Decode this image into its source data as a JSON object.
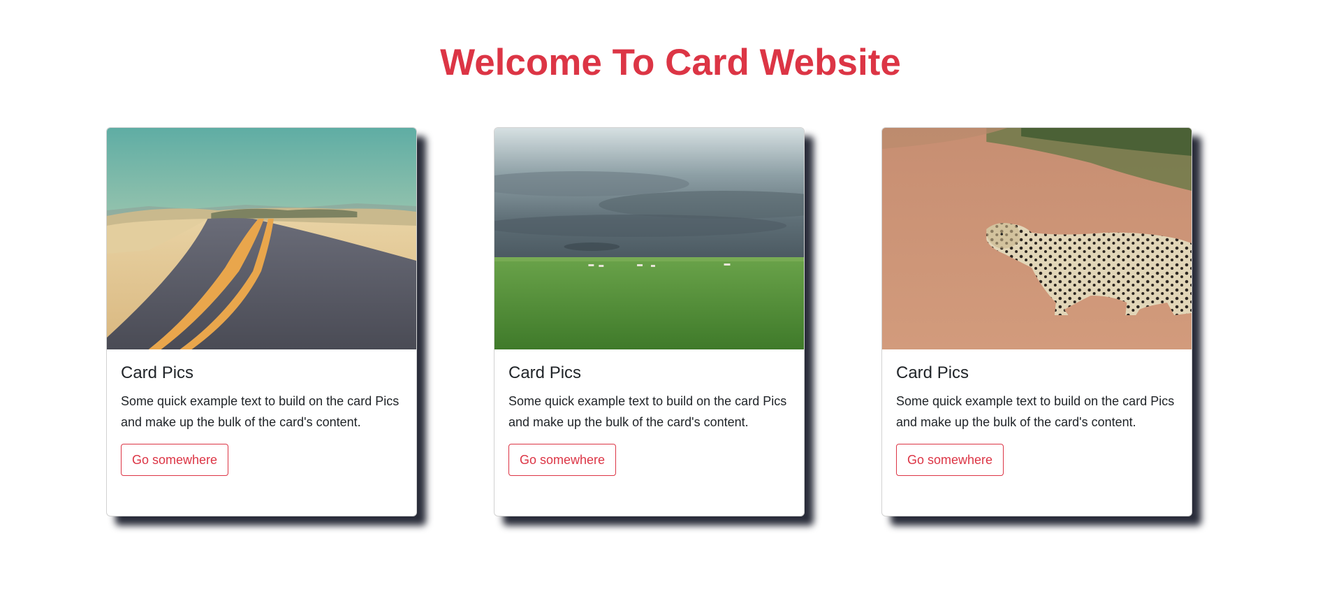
{
  "page": {
    "title": "Welcome To Card Website"
  },
  "colors": {
    "accent": "#dc3545",
    "text": "#212529",
    "shadow": "#2a2d3a"
  },
  "cards": [
    {
      "image": "desert-road-photo",
      "title": "Card Pics",
      "text": "Some quick example text to build on the card Pics and make up the bulk of the card's content.",
      "button_label": "Go somewhere"
    },
    {
      "image": "stormy-grassland-photo",
      "title": "Card Pics",
      "text": "Some quick example text to build on the card Pics and make up the bulk of the card's content.",
      "button_label": "Go somewhere"
    },
    {
      "image": "leopard-photo",
      "title": "Card Pics",
      "text": "Some quick example text to build on the card Pics and make up the bulk of the card's content.",
      "button_label": "Go somewhere"
    }
  ]
}
